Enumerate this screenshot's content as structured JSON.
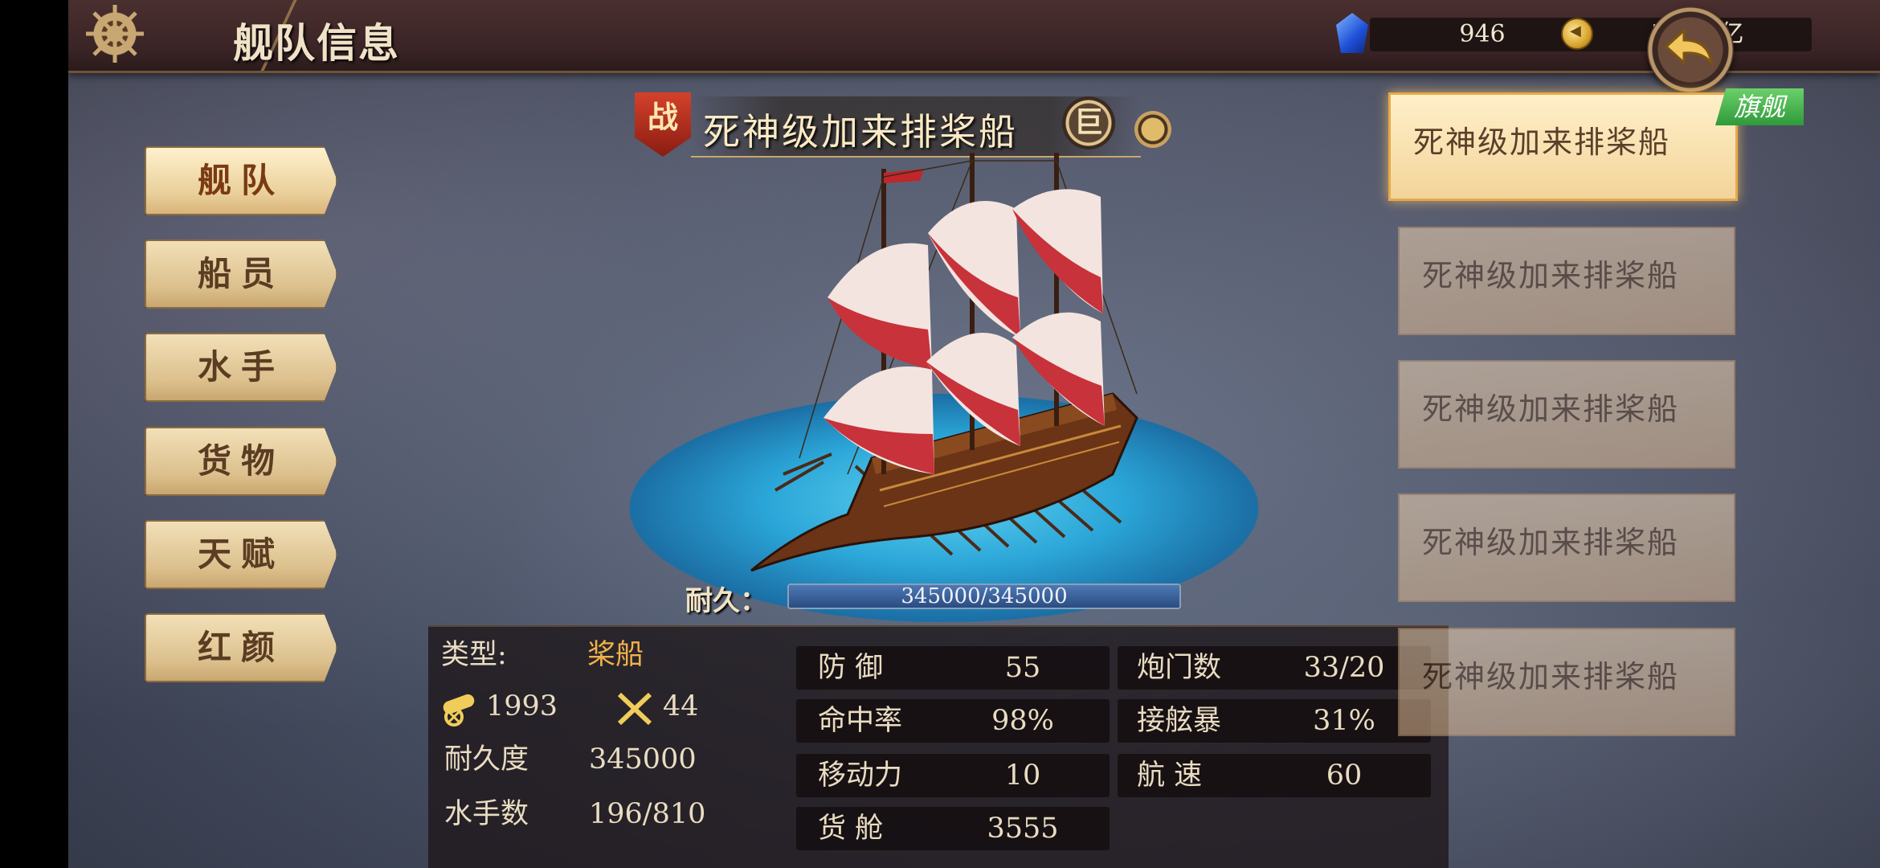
{
  "header": {
    "title": "舰队信息",
    "gems": "946",
    "coins": "578.8亿"
  },
  "menu": [
    {
      "label": "舰队",
      "active": true
    },
    {
      "label": "船员",
      "active": false
    },
    {
      "label": "水手",
      "active": false
    },
    {
      "label": "货物",
      "active": false
    },
    {
      "label": "天赋",
      "active": false
    },
    {
      "label": "红颜",
      "active": false
    }
  ],
  "ship": {
    "battle_badge": "战",
    "name": "死神级加来排桨船",
    "size_badge": "巨",
    "durability_label": "耐久：",
    "durability_text": "345000/345000",
    "durability_fraction": 1.0
  },
  "stats": {
    "type_label": "类型:",
    "type_value": "桨船",
    "cannon_value": "1993",
    "melee_value": "44",
    "durability_label": "耐久度",
    "durability_value": "345000",
    "sailors_label": "水手数",
    "sailors_value": "196/810",
    "defense_label": "防 御",
    "defense_value": "55",
    "hit_label": "命中率",
    "hit_value": "98%",
    "mobility_label": "移动力",
    "mobility_value": "10",
    "cargo_label": "货 舱",
    "cargo_value": "3555",
    "gunports_label": "炮门数",
    "gunports_value": "33/20",
    "boarding_label": "接舷暴",
    "boarding_value": "31%",
    "speed_label": "航 速",
    "speed_value": "60"
  },
  "fleet_list": {
    "flagship_tag": "旗舰",
    "ships": [
      {
        "name": "死神级加来排桨船",
        "active": true
      },
      {
        "name": "死神级加来排桨船",
        "active": false
      },
      {
        "name": "死神级加来排桨船",
        "active": false
      },
      {
        "name": "死神级加来排桨船",
        "active": false
      },
      {
        "name": "死神级加来排桨船",
        "active": false
      }
    ]
  },
  "icons": {
    "wheel": "ship-wheel-icon",
    "gem": "gem-icon",
    "coin": "coin-icon",
    "back": "back-arrow-icon",
    "cannon": "cannon-icon",
    "swords": "crossed-swords-icon",
    "switch": "switch-icon"
  },
  "colors": {
    "accent_gold": "#f1b24a",
    "flag_tag_green": "#2f9a3a",
    "battle_red": "#8a1c12"
  }
}
